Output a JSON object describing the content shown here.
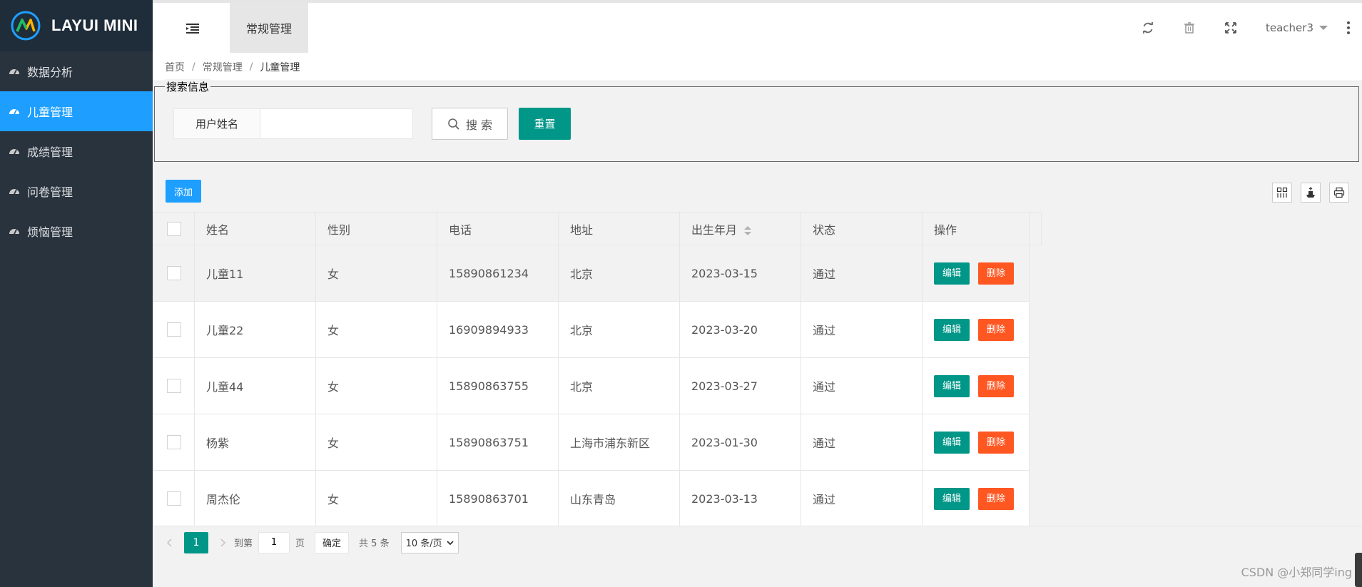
{
  "app": {
    "logo_text": "LAYUI MINI"
  },
  "sidebar": {
    "items": [
      {
        "label": "数据分析",
        "active": false
      },
      {
        "label": "儿童管理",
        "active": true
      },
      {
        "label": "成绩管理",
        "active": false
      },
      {
        "label": "问卷管理",
        "active": false
      },
      {
        "label": "烦恼管理",
        "active": false
      }
    ]
  },
  "header": {
    "tab_label": "常规管理",
    "user": "teacher3",
    "icons": [
      "refresh-icon",
      "trash-icon",
      "fullscreen-icon",
      "more-icon"
    ]
  },
  "breadcrumb": [
    "首页",
    "常规管理",
    "儿童管理"
  ],
  "search": {
    "legend": "搜索信息",
    "field_label": "用户姓名",
    "field_value": "",
    "search_label": "搜 索",
    "reset_label": "重置"
  },
  "toolbar": {
    "add_label": "添加",
    "icons": [
      "columns-icon",
      "export-icon",
      "print-icon"
    ]
  },
  "table": {
    "headers": [
      "姓名",
      "性别",
      "电话",
      "地址",
      "出生年月",
      "状态",
      "操作"
    ],
    "rows": [
      {
        "name": "儿童11",
        "sex": "女",
        "phone": "15890861234",
        "addr": "北京",
        "birth": "2023-03-15",
        "status": "通过"
      },
      {
        "name": "儿童22",
        "sex": "女",
        "phone": "16909894933",
        "addr": "北京",
        "birth": "2023-03-20",
        "status": "通过"
      },
      {
        "name": "儿童44",
        "sex": "女",
        "phone": "15890863755",
        "addr": "北京",
        "birth": "2023-03-27",
        "status": "通过"
      },
      {
        "name": "杨紫",
        "sex": "女",
        "phone": "15890863751",
        "addr": "上海市浦东新区",
        "birth": "2023-01-30",
        "status": "通过"
      },
      {
        "name": "周杰伦",
        "sex": "女",
        "phone": "15890863701",
        "addr": "山东青岛",
        "birth": "2023-03-13",
        "status": "通过"
      }
    ],
    "edit_label": "编辑",
    "delete_label": "删除"
  },
  "pager": {
    "current": "1",
    "goto_prefix": "到第",
    "goto_value": "1",
    "goto_suffix": "页",
    "ok_label": "确定",
    "total": "共 5 条",
    "page_size": "10 条/页"
  },
  "watermark": "CSDN @小郑同学ing",
  "colors": {
    "sidebar": "#28333e",
    "active": "#1e9fff",
    "primary": "#009688",
    "danger": "#ff5722"
  }
}
